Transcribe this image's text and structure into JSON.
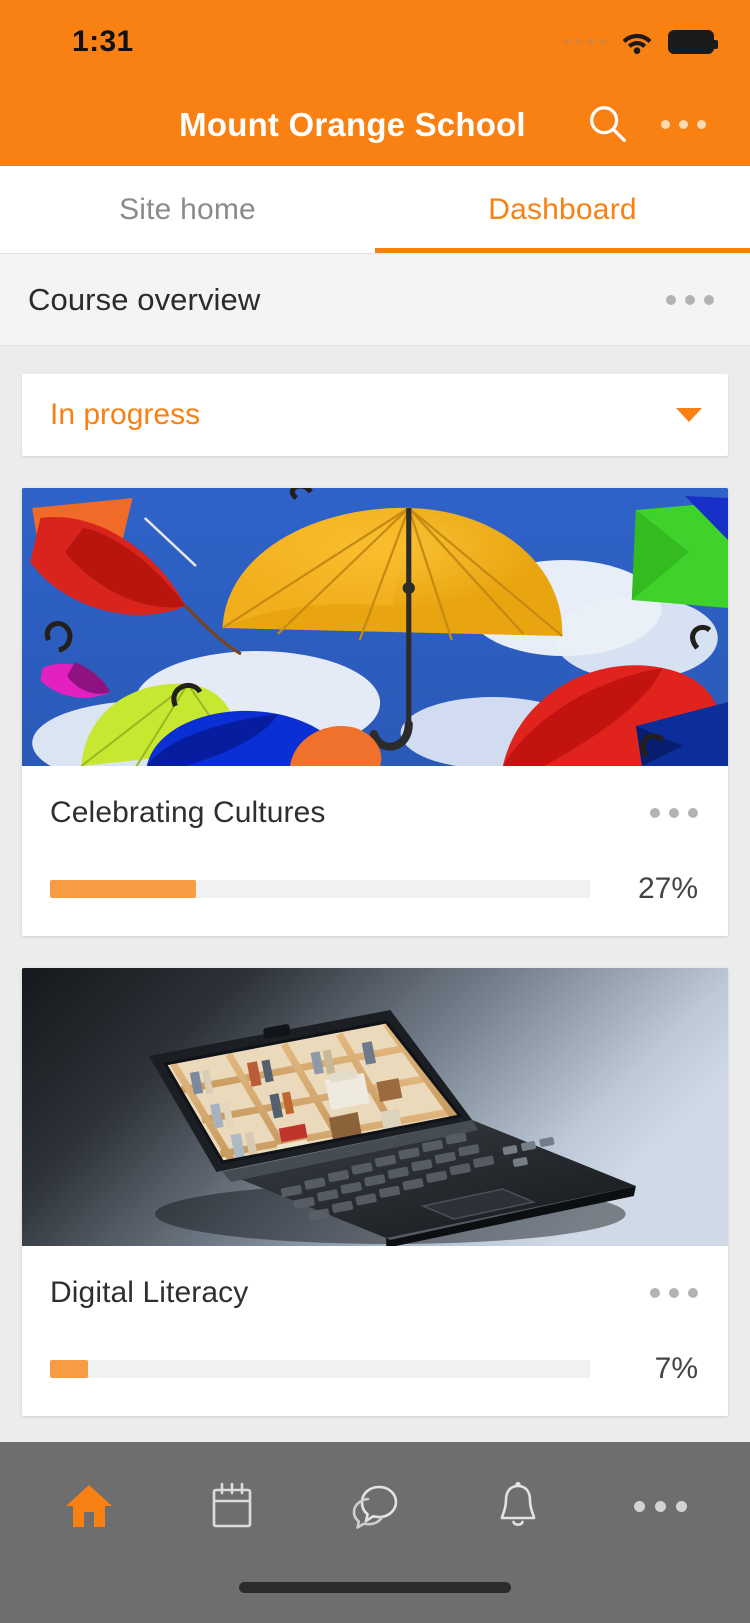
{
  "status_bar": {
    "time": "1:31",
    "signal_icon": "signal-dots-icon",
    "wifi_icon": "wifi-icon",
    "battery_icon": "battery-full-icon"
  },
  "header": {
    "title": "Mount Orange School",
    "search_icon": "search-icon",
    "more_icon": "more-options-icon",
    "background_color": "#F98012"
  },
  "tabs": [
    {
      "label": "Site home",
      "active": false
    },
    {
      "label": "Dashboard",
      "active": true
    }
  ],
  "section": {
    "title": "Course overview",
    "more_icon": "more-options-icon"
  },
  "filter": {
    "selected": "In progress",
    "caret_icon": "chevron-down-icon"
  },
  "courses": [
    {
      "title": "Celebrating Cultures",
      "progress_percent": 27,
      "progress_label": "27%",
      "more_icon": "more-options-icon",
      "image_alt": "colourful-umbrellas-in-blue-sky"
    },
    {
      "title": "Digital Literacy",
      "progress_percent": 7,
      "progress_label": "7%",
      "more_icon": "more-options-icon",
      "image_alt": "laptop-showing-bookshelf"
    }
  ],
  "bottom_nav": [
    {
      "name": "home",
      "icon": "home-icon",
      "active": true
    },
    {
      "name": "calendar",
      "icon": "calendar-icon",
      "active": false
    },
    {
      "name": "messages",
      "icon": "chat-bubbles-icon",
      "active": false
    },
    {
      "name": "notifications",
      "icon": "bell-icon",
      "active": false
    },
    {
      "name": "more",
      "icon": "more-options-icon",
      "active": false
    }
  ],
  "colors": {
    "accent": "#F98012",
    "progress_fill": "#F79C42",
    "nav_bar_bg": "#6E6E6E",
    "page_bg": "#ECECEC"
  }
}
